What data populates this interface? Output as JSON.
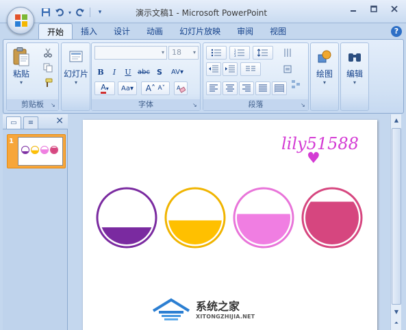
{
  "window": {
    "title": "演示文稿1 - Microsoft PowerPoint"
  },
  "qat": [
    "save-icon",
    "undo-icon",
    "redo-icon",
    "customize-icon"
  ],
  "tabs": [
    "开始",
    "插入",
    "设计",
    "动画",
    "幻灯片放映",
    "审阅",
    "视图"
  ],
  "ribbon": {
    "clipboard": {
      "label": "剪贴板",
      "paste": "粘贴"
    },
    "slides": {
      "label": "幻灯片",
      "new_slide": "幻灯片"
    },
    "font": {
      "label": "字体",
      "font_size": "18",
      "font_name": ""
    },
    "paragraph": {
      "label": "段落"
    },
    "drawing": {
      "label": "绘图"
    },
    "editing": {
      "label": "编辑"
    }
  },
  "slide_panel": {
    "slide_number": "1"
  },
  "slide": {
    "watermark_text": "lily51588",
    "circles": [
      {
        "name": "purple",
        "color": "#7a2aa0",
        "border": "#7a2aa0",
        "fill_level": 0.32
      },
      {
        "name": "yellow",
        "color": "#ffc000",
        "border": "#f0b400",
        "fill_level": 0.45
      },
      {
        "name": "pink",
        "color": "#f07ee2",
        "border": "#e874d9",
        "fill_level": 0.57
      },
      {
        "name": "rose",
        "color": "#d6467f",
        "border": "#d6467f",
        "fill_level": 0.8
      }
    ]
  },
  "brand": {
    "name": "系统之家",
    "url": "XITONGZHIJIA.NET"
  }
}
